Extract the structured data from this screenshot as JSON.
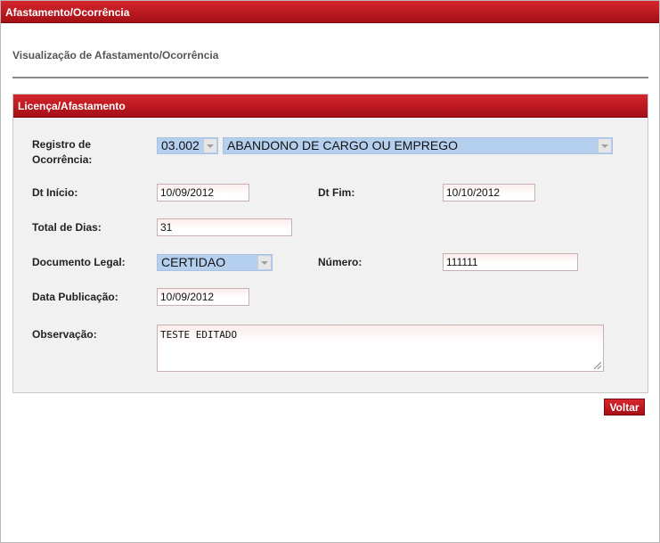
{
  "window": {
    "title": "Afastamento/Ocorrência"
  },
  "page": {
    "subtitle": "Visualização de Afastamento/Ocorrência"
  },
  "panel": {
    "title": "Licença/Afastamento"
  },
  "form": {
    "registro": {
      "label": "Registro de Ocorrência:",
      "code": "03.002",
      "description": "ABANDONO DE CARGO OU EMPREGO"
    },
    "dt_inicio": {
      "label": "Dt Início:",
      "value": "10/09/2012"
    },
    "dt_fim": {
      "label": "Dt Fim:",
      "value": "10/10/2012"
    },
    "total_dias": {
      "label": "Total de Dias:",
      "value": "31"
    },
    "documento_legal": {
      "label": "Documento Legal:",
      "value": "CERTIDAO"
    },
    "numero": {
      "label": "Número:",
      "value": "111111"
    },
    "data_publicacao": {
      "label": "Data Publicação:",
      "value": "10/09/2012"
    },
    "observacao": {
      "label": "Observação:",
      "value": "TESTE EDITADO"
    }
  },
  "actions": {
    "voltar": "Voltar"
  },
  "colors": {
    "accent_red": "#c41a21",
    "select_blue": "#b5d0ef",
    "panel_bg": "#f1f1f1"
  }
}
